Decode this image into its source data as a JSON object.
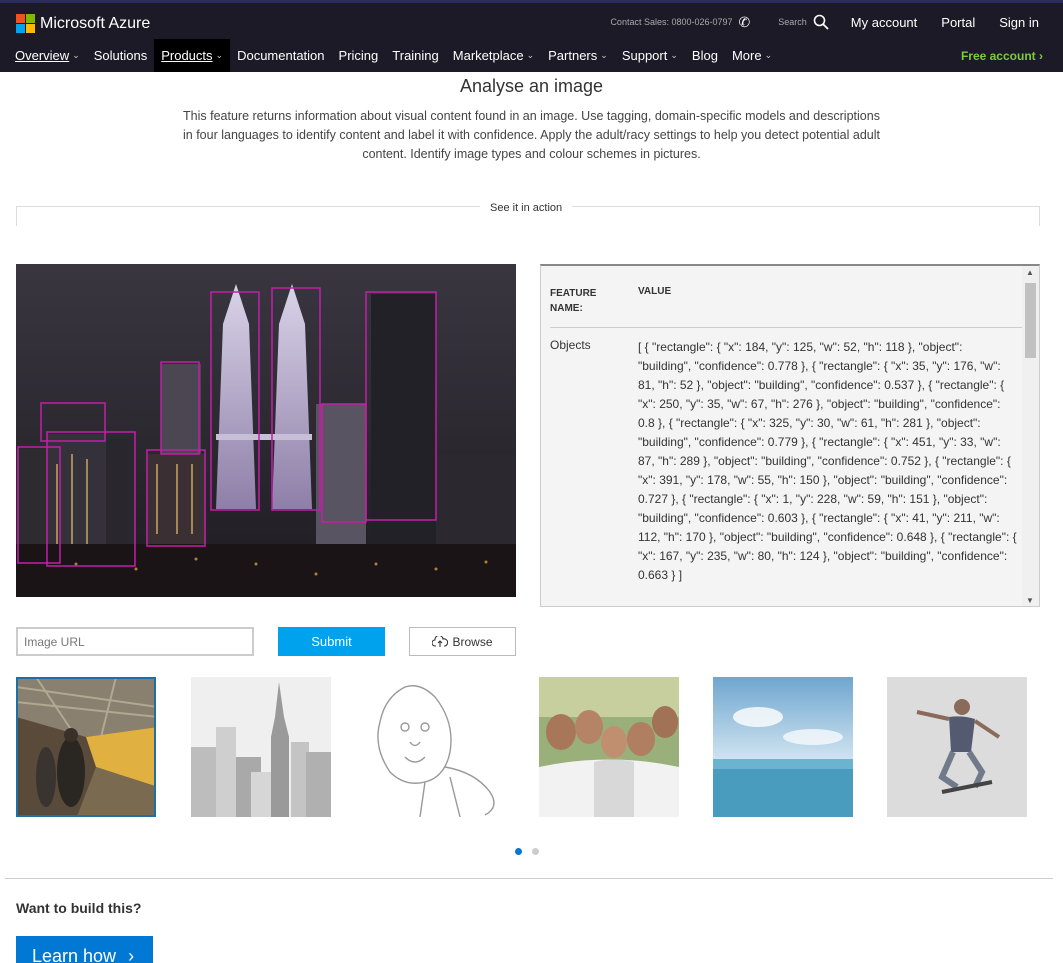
{
  "header": {
    "brand": "Microsoft Azure",
    "logo_colors": [
      "#f25022",
      "#7fba00",
      "#00a4ef",
      "#ffb900"
    ],
    "contact_sales": "Contact Sales: 0800-026-0797",
    "search_label": "Search",
    "links": [
      "My account",
      "Portal",
      "Sign in"
    ],
    "nav": [
      {
        "label": "Overview",
        "chevron": true
      },
      {
        "label": "Solutions",
        "chevron": false
      },
      {
        "label": "Products",
        "chevron": true
      },
      {
        "label": "Documentation",
        "chevron": false
      },
      {
        "label": "Pricing",
        "chevron": false
      },
      {
        "label": "Training",
        "chevron": false
      },
      {
        "label": "Marketplace",
        "chevron": true
      },
      {
        "label": "Partners",
        "chevron": true
      },
      {
        "label": "Support",
        "chevron": true
      },
      {
        "label": "Blog",
        "chevron": false
      },
      {
        "label": "More",
        "chevron": true
      }
    ],
    "free_account": "Free account"
  },
  "main": {
    "title": "Analyse an image",
    "description": "This feature returns information about visual content found in an image. Use tagging, domain-specific models and descriptions in four languages to identify content and label it with confidence. Apply the adult/racy settings to help you detect potential adult content. Identify image types and colour schemes in pictures.",
    "section_label": "See it in action"
  },
  "results": {
    "col_feature": "FEATURE NAME:",
    "col_value": "VALUE",
    "row_name": "Objects",
    "row_value": "[ { \"rectangle\": { \"x\": 184, \"y\": 125, \"w\": 52, \"h\": 118 }, \"object\": \"building\", \"confidence\": 0.778 }, { \"rectangle\": { \"x\": 35, \"y\": 176, \"w\": 81, \"h\": 52 }, \"object\": \"building\", \"confidence\": 0.537 }, { \"rectangle\": { \"x\": 250, \"y\": 35, \"w\": 67, \"h\": 276 }, \"object\": \"building\", \"confidence\": 0.8 }, { \"rectangle\": { \"x\": 325, \"y\": 30, \"w\": 61, \"h\": 281 }, \"object\": \"building\", \"confidence\": 0.779 }, { \"rectangle\": { \"x\": 451, \"y\": 33, \"w\": 87, \"h\": 289 }, \"object\": \"building\", \"confidence\": 0.752 }, { \"rectangle\": { \"x\": 391, \"y\": 178, \"w\": 55, \"h\": 150 }, \"object\": \"building\", \"confidence\": 0.727 }, { \"rectangle\": { \"x\": 1, \"y\": 228, \"w\": 59, \"h\": 151 }, \"object\": \"building\", \"confidence\": 0.603 }, { \"rectangle\": { \"x\": 41, \"y\": 211, \"w\": 112, \"h\": 170 }, \"object\": \"building\", \"confidence\": 0.648 }, { \"rectangle\": { \"x\": 167, \"y\": 235, \"w\": 80, \"h\": 124 }, \"object\": \"building\", \"confidence\": 0.663 } ]"
  },
  "form": {
    "url_placeholder": "Image URL",
    "submit": "Submit",
    "browse": "Browse"
  },
  "footer": {
    "heading": "Want to build this?",
    "learn": "Learn how"
  }
}
